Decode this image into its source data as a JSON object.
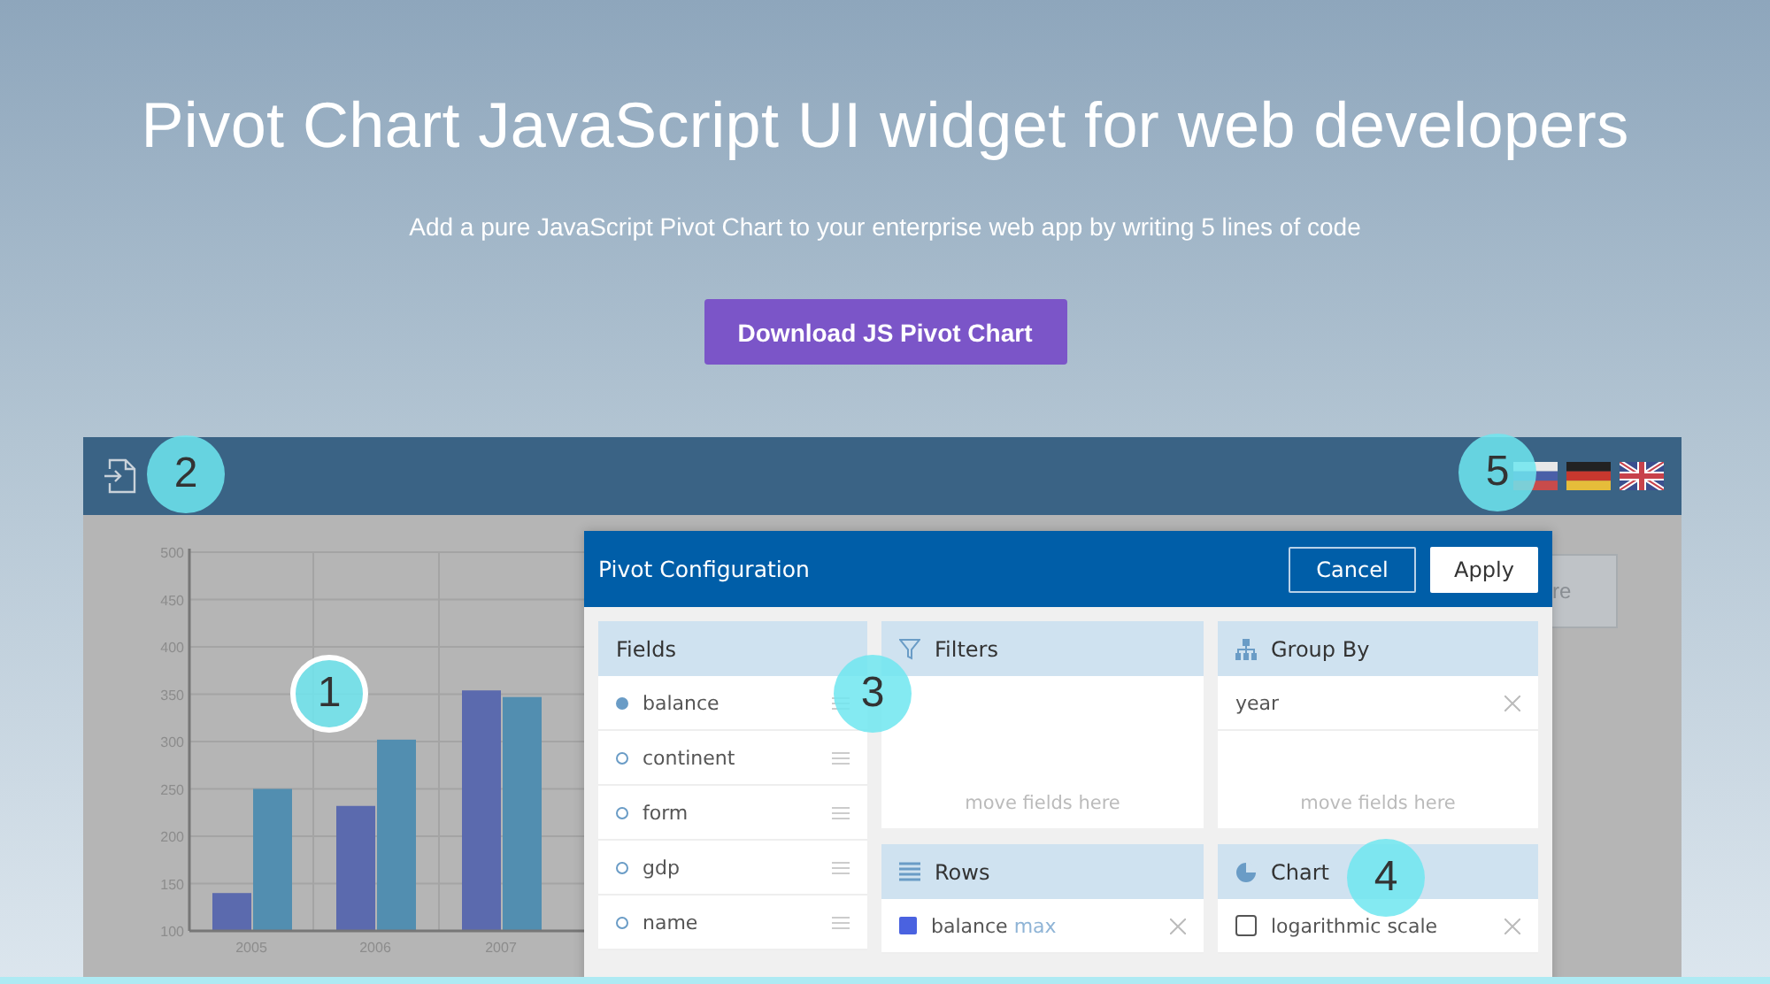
{
  "hero": {
    "title": "Pivot Chart JavaScript UI widget for web developers",
    "subtitle": "Add a pure JavaScript Pivot Chart to your enterprise web app by writing 5 lines of code",
    "button": "Download JS Pivot Chart"
  },
  "chart": {
    "chart_data": {
      "type": "bar",
      "categories": [
        "2005",
        "2006",
        "2007"
      ],
      "series": [
        {
          "color": "#5b6aae",
          "values": [
            140,
            232,
            354
          ]
        },
        {
          "color": "#528eb0",
          "values": [
            250,
            302,
            347
          ]
        }
      ],
      "grid": true,
      "ylim": [
        100,
        500
      ],
      "yticks": [
        100,
        150,
        200,
        250,
        300,
        350,
        400,
        450,
        500
      ]
    }
  },
  "background_button": {
    "label": "re"
  },
  "config": {
    "title": "Pivot Configuration",
    "buttons": [
      {
        "label": "Cancel",
        "kind": "outline"
      },
      {
        "label": "Apply",
        "kind": "solid"
      }
    ],
    "fields": {
      "title": "Fields",
      "items": [
        {
          "label": "balance",
          "used": true
        },
        {
          "label": "continent",
          "used": false
        },
        {
          "label": "form",
          "used": false
        },
        {
          "label": "gdp",
          "used": false
        },
        {
          "label": "name",
          "used": false
        }
      ]
    },
    "filters": {
      "title": "Filters",
      "hint": "move fields here"
    },
    "rows": {
      "title": "Rows",
      "items": [
        {
          "label": "balance",
          "aggregate": "max",
          "color": "#4a62e0"
        }
      ]
    },
    "group_by": {
      "title": "Group By",
      "items": [
        {
          "label": "year"
        }
      ],
      "hint": "move fields here"
    },
    "chart": {
      "title": "Chart",
      "options": [
        {
          "kind": "checkbox",
          "label": "logarithmic scale",
          "checked": false
        }
      ]
    }
  },
  "badges": [
    {
      "label": "1",
      "ringed": true
    },
    {
      "label": "2",
      "ringed": false
    },
    {
      "label": "3",
      "ringed": false
    },
    {
      "label": "4",
      "ringed": false
    },
    {
      "label": "5",
      "ringed": false
    }
  ]
}
